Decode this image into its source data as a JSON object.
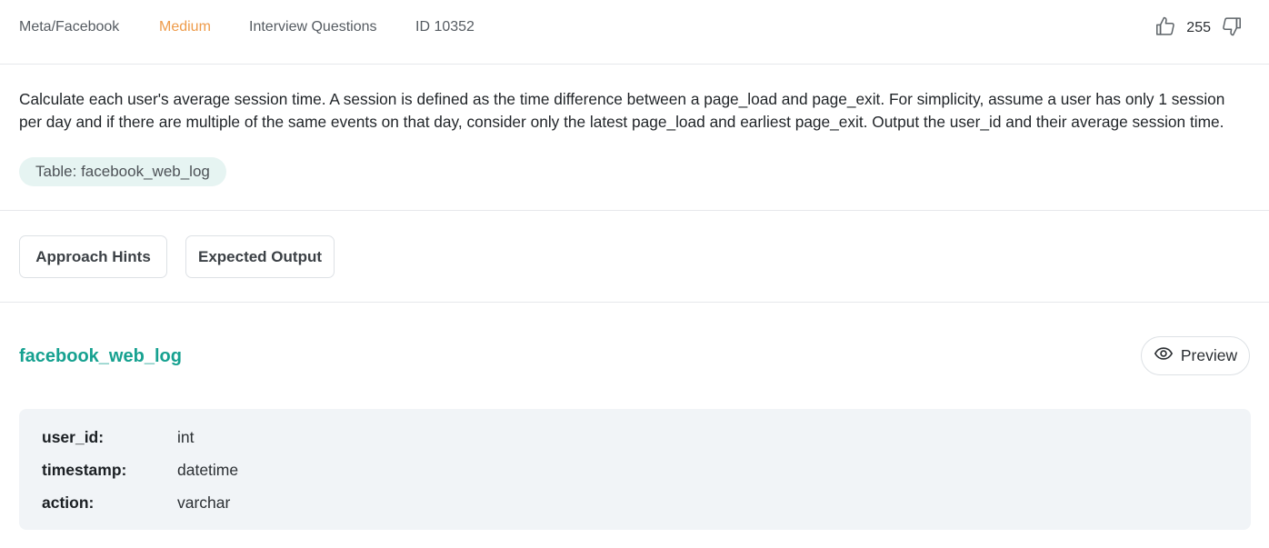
{
  "header": {
    "company": "Meta/Facebook",
    "difficulty": "Medium",
    "category": "Interview Questions",
    "question_id": "ID 10352",
    "votes": "255",
    "like_icon": "thumbs-up-icon",
    "dislike_icon": "thumbs-down-icon",
    "difficulty_color": "#ee9b4a"
  },
  "question": {
    "text": "Calculate each user's average session time. A session is defined as the time difference between a page_load and page_exit. For simplicity, assume a user has only 1 session per day and if there are multiple of the same events on that day, consider only the latest page_load and earliest page_exit. Output the user_id and their average session time.",
    "table_tag": "Table: facebook_web_log"
  },
  "hints": {
    "approach_label": "Approach Hints",
    "expected_label": "Expected Output"
  },
  "schema": {
    "table_name": "facebook_web_log",
    "preview_label": "Preview",
    "preview_icon": "eye-icon",
    "accent_color": "#16a190",
    "columns": [
      {
        "name": "user_id:",
        "type": "int"
      },
      {
        "name": "timestamp:",
        "type": "datetime"
      },
      {
        "name": "action:",
        "type": "varchar"
      }
    ]
  }
}
